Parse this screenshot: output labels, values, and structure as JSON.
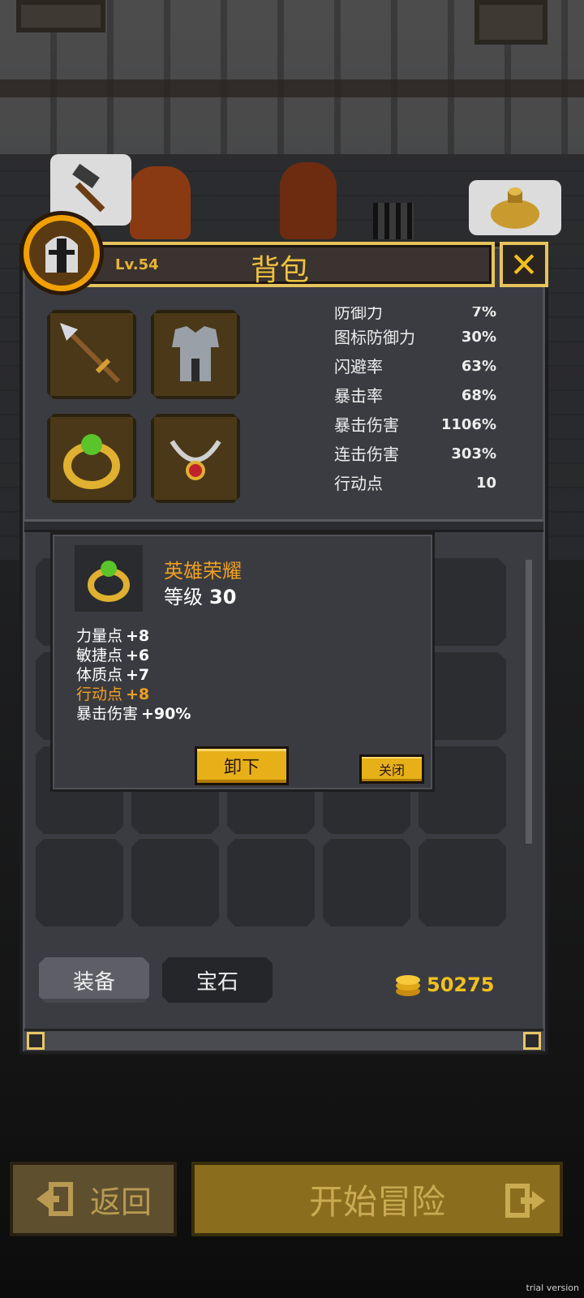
{
  "header": {
    "level": "Lv.54",
    "title": "背包",
    "close_icon": "close-x-icon"
  },
  "equipment_slots": [
    {
      "name": "spear",
      "icon": "spear-icon"
    },
    {
      "name": "armor",
      "icon": "armor-icon"
    },
    {
      "name": "ring",
      "icon": "ring-icon"
    },
    {
      "name": "necklace",
      "icon": "necklace-icon"
    }
  ],
  "stats": [
    {
      "label": "防御力",
      "value": "7%"
    },
    {
      "label": "图标防御力",
      "value": "30%"
    },
    {
      "label": "闪避率",
      "value": "63%"
    },
    {
      "label": "暴击率",
      "value": "68%"
    },
    {
      "label": "暴击伤害",
      "value": "1106%"
    },
    {
      "label": "连击伤害",
      "value": "303%"
    },
    {
      "label": "行动点",
      "value": "10"
    }
  ],
  "tooltip": {
    "item_name": "英雄荣耀",
    "level_label": "等级",
    "level_value": "30",
    "attributes": [
      {
        "label": "力量点",
        "value": "+8",
        "highlight": false
      },
      {
        "label": "敏捷点",
        "value": "+6",
        "highlight": false
      },
      {
        "label": "体质点",
        "value": "+7",
        "highlight": false
      },
      {
        "label": "行动点",
        "value": "+8",
        "highlight": true
      },
      {
        "label": "暴击伤害",
        "value": "+90%",
        "highlight": false
      }
    ],
    "unequip_label": "卸下",
    "close_label": "关闭"
  },
  "tabs": {
    "equipment": "装备",
    "gems": "宝石",
    "active": "装备"
  },
  "gold": "50275",
  "bottom": {
    "back_label": "返回",
    "start_label": "开始冒险"
  },
  "watermark": "trial version",
  "colors": {
    "accent_gold": "#f2c01e",
    "item_name_orange": "#f0a020",
    "panel_bg": "#3b3c41"
  }
}
